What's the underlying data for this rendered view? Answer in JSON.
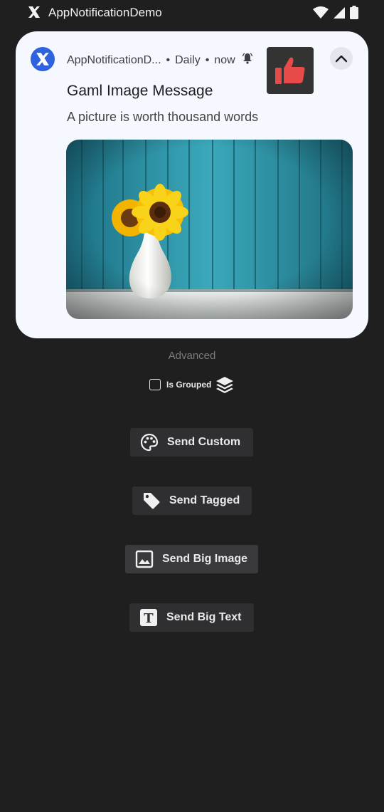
{
  "status_bar": {
    "title": "AppNotificationDemo",
    "icons": [
      "app-x-icon",
      "wifi-icon",
      "signal-icon",
      "battery-icon"
    ]
  },
  "notification": {
    "app_name": "AppNotificationD...",
    "separator": "•",
    "channel": "Daily",
    "time": "now",
    "title": "Gaml Image Message",
    "text": "A picture is worth thousand words",
    "large_icon": "thumbs-up-icon",
    "colors": {
      "card": "#f6f8ff",
      "app_icon": "#2f63dd",
      "thumb": "#e84a4a"
    }
  },
  "main": {
    "section_label": "Advanced",
    "grouped_checkbox_label": "Is Grouped",
    "grouped_checked": false,
    "buttons": [
      {
        "label": "Send Custom",
        "icon": "palette-icon"
      },
      {
        "label": "Send Tagged",
        "icon": "tag-icon"
      },
      {
        "label": "Send Big Image",
        "icon": "image-icon"
      },
      {
        "label": "Send Big Text",
        "icon": "text-icon"
      }
    ]
  }
}
